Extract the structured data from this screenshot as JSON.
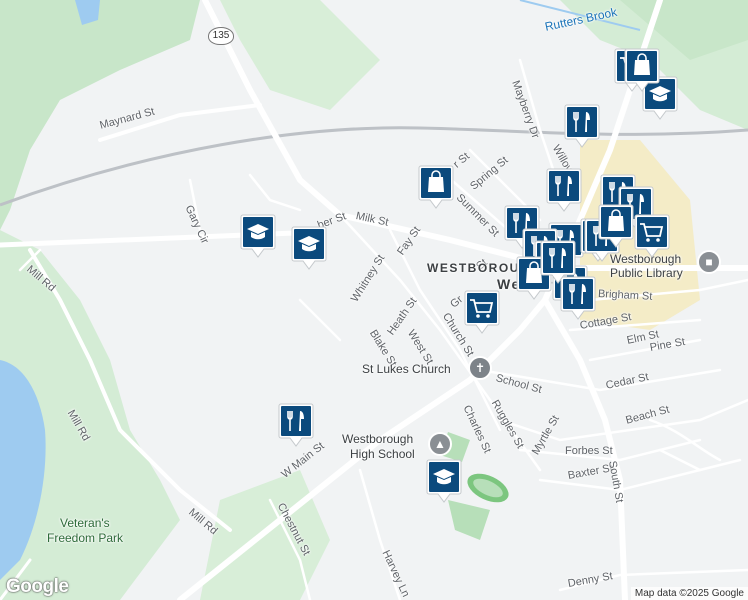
{
  "route_shield": "135",
  "streets": {
    "maynard_st": "Maynard St",
    "gary_cir": "Gary Cir",
    "mill_rd_north": "Mill Rd",
    "mill_rd_west": "Mill Rd",
    "mill_rd_south": "Mill Rd",
    "milk_st": "Milk St",
    "fay_st": "Fay St",
    "whitney_st": "Whitney St",
    "heath_st": "Heath St",
    "west_st": "West St",
    "blake_st": "Blake St",
    "church_st": "Church St",
    "spring_st": "Spring St",
    "summer_st": "Summer St",
    "mayberry_dr": "Mayberry Dr",
    "willow_st": "Willow St",
    "brigham_st": "Brigham St",
    "cottage_st": "Cottage St",
    "elm_st": "Elm St",
    "pine_st": "Pine St",
    "school_st": "School St",
    "cedar_st": "Cedar St",
    "beach_st": "Beach St",
    "ruggles_st": "Ruggles St",
    "charles_st": "Charles St",
    "myrtle_st": "Myrtle St",
    "forbes_st": "Forbes St",
    "baxter_st": "Baxter St",
    "south_st": "South St",
    "w_main_st": "W Main St",
    "chestnut_st": "Chestnut St",
    "harvey_ln": "Harvey Ln",
    "denny_st": "Denny St",
    "partial_ber_st": "ber St",
    "partial_r_st": "r St",
    "partial_gr": "Gr",
    "partial_st": "St"
  },
  "places": {
    "rutters_brook": "Rutters Brook",
    "westborough_town": "WESTBOROU",
    "we_partial": "We",
    "library_line1": "Westborough",
    "library_line2": "Public Library",
    "st_lukes": "St Lukes Church",
    "high_school_line1": "Westborough",
    "high_school_line2": "High School",
    "park_line1": "Veteran's",
    "park_line2": "Freedom Park"
  },
  "markers": [
    {
      "type": "shopping-bag",
      "color": "#0b4a7d"
    },
    {
      "type": "school",
      "color": "#0b4a7d"
    },
    {
      "type": "restaurant",
      "color": "#0b4a7d"
    },
    {
      "type": "grocery-cart",
      "color": "#0b4a7d"
    }
  ],
  "colors": {
    "pin_fill": "#0b4a7d",
    "park_green": "#c8e6c9",
    "water_blue": "#9ecbf0",
    "road_white": "#ffffff",
    "downtown_yellow": "#f5e6a3"
  },
  "footer": {
    "logo": "Google",
    "attribution": "Map data ©2025 Google"
  }
}
